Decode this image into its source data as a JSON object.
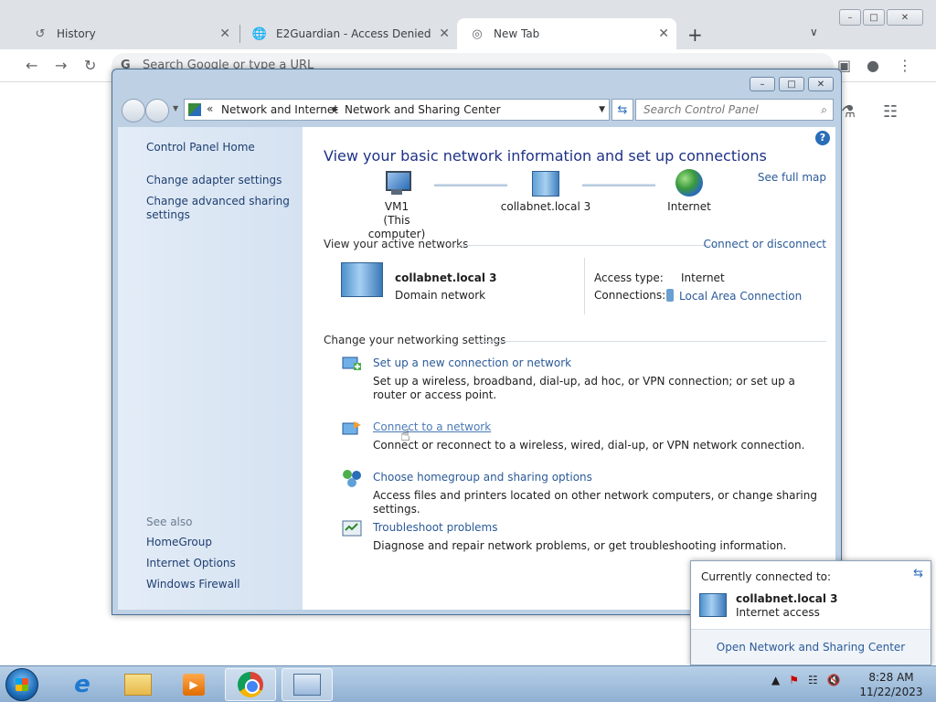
{
  "browser": {
    "tabs": [
      {
        "label": "History",
        "icon": "history-icon"
      },
      {
        "label": "E2Guardian - Access Denied",
        "icon": "globe-icon"
      },
      {
        "label": "New Tab",
        "icon": "chrome-icon"
      }
    ],
    "omnibox_placeholder": "Search Google or type a URL"
  },
  "window": {
    "breadcrumb": [
      "Network and Internet",
      "Network and Sharing Center"
    ],
    "search_placeholder": "Search Control Panel"
  },
  "sidebar": {
    "home": "Control Panel Home",
    "links": [
      "Change adapter settings",
      "Change advanced sharing settings"
    ],
    "see_also_label": "See also",
    "see_also": [
      "HomeGroup",
      "Internet Options",
      "Windows Firewall"
    ]
  },
  "main": {
    "title": "View your basic network information and set up connections",
    "see_full_map": "See full map",
    "map": {
      "computer_name": "VM1",
      "computer_sub": "(This computer)",
      "network_name": "collabnet.local  3",
      "internet": "Internet"
    },
    "active_networks_label": "View your active networks",
    "connect_or_disconnect": "Connect or disconnect",
    "active_network": {
      "name": "collabnet.local  3",
      "type": "Domain network",
      "access_type_label": "Access type:",
      "access_type": "Internet",
      "connections_label": "Connections:",
      "connection": "Local Area Connection"
    },
    "settings_label": "Change your networking settings",
    "tasks": [
      {
        "link": "Set up a new connection or network",
        "desc": "Set up a wireless, broadband, dial-up, ad hoc, or VPN connection; or set up a router or access point."
      },
      {
        "link": "Connect to a network",
        "desc": "Connect or reconnect to a wireless, wired, dial-up, or VPN network connection."
      },
      {
        "link": "Choose homegroup and sharing options",
        "desc": "Access files and printers located on other network computers, or change sharing settings."
      },
      {
        "link": "Troubleshoot problems",
        "desc": "Diagnose and repair network problems, or get troubleshooting information."
      }
    ]
  },
  "flyout": {
    "header": "Currently connected to:",
    "network_name": "collabnet.local  3",
    "status": "Internet access",
    "open_link": "Open Network and Sharing Center"
  },
  "taskbar": {
    "time": "8:28 AM",
    "date": "11/22/2023"
  }
}
